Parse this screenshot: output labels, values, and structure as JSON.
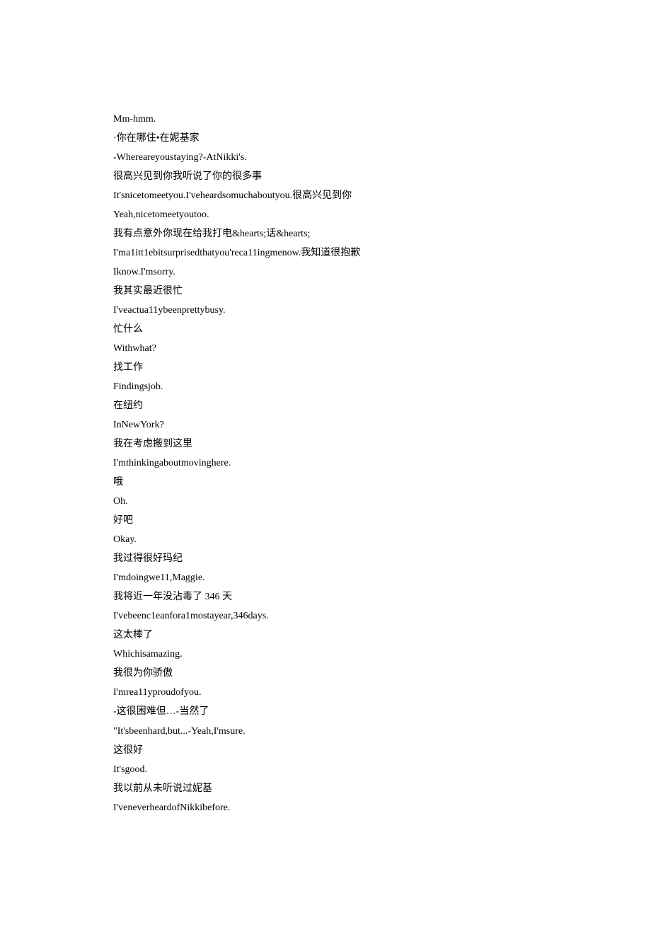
{
  "lines": [
    "Mm-hmm.",
    "·你在哪住•在妮基家",
    "-Whereareyoustaying?-AtNikki's.",
    "很高兴见到你我听说了你的很多事",
    "It'snicetomeetyou.I'veheardsomuchaboutyou.很高兴见到你",
    "Yeah,nicetomeetyoutoo.",
    "我有点意外你现在给我打电&hearts;话&hearts;",
    "I'ma1itt1ebitsurprisedthatyou'reca11ingmenow.我知道很抱歉",
    "Iknow.I'msorry.",
    "我其实最近很忙",
    "I'veactua11ybeenprettybusy.",
    "忙什么",
    "Withwhat?",
    "找工作",
    "Findingsjob.",
    "在纽约",
    "InNewYork?",
    "我在考虑搬到这里",
    "I'mthinkingaboutmovinghere.",
    "哦",
    "Oh.",
    "好吧",
    "Okay.",
    "我过得很好玛纪",
    "I'mdoingwe11,Maggie.",
    "我将近一年没沾毒了 346 天",
    "I'vebeenc1eanfora1mostayear,346days.",
    "这太棒了",
    "Whichisamazing.",
    "我很为你骄傲",
    "I'mrea11yproudofyou.",
    "-这很困难但…-当然了",
    "\"It'sbeenhard,but...-Yeah,I'msure.",
    "这很好",
    "It'sgood.",
    "我以前从未听说过妮基",
    "I'veneverheardofNikkibefore."
  ]
}
